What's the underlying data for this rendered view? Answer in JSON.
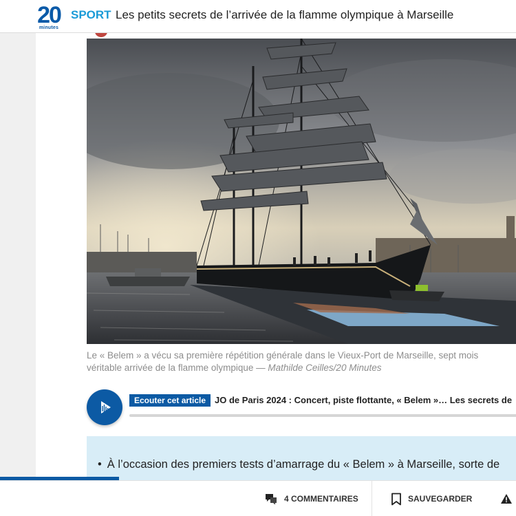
{
  "header": {
    "logo_text": "20",
    "logo_subtext": "minutes",
    "section": "SPORT",
    "headline": "Les petits secrets de l’arrivée de la flamme olympique à Marseille"
  },
  "article": {
    "photo_alt": "Le « Belem » à quai dans le Vieux-Port de Marseille",
    "caption": "Le « Belem » a vécu sa première répétition générale dans le Vieux-Port de Marseille, sept mois",
    "caption_line2": "véritable arrivée de la flamme olympique —",
    "caption_credit": "Mathilde Ceilles/20 Minutes",
    "audio": {
      "badge": "Ecouter cet article",
      "title": "JO de Paris 2024 : Concert, piste flottante, « Belem »… Les secrets de"
    },
    "summary_item": "À l’occasion des premiers tests d’amarrage du « Belem » à Marseille, sorte de"
  },
  "reading_progress": 0.23,
  "bottombar": {
    "comments_label": "4 COMMENTAIRES",
    "save_label": "SAUVEGARDER"
  },
  "icons": {
    "comments": "comments-icon",
    "bookmark": "bookmark-icon",
    "alert": "alert-icon",
    "play": "audio-play-icon"
  },
  "colors": {
    "brand_blue": "#0c5aa4",
    "section_blue": "#1b9bd7",
    "summary_bg": "#d8edf7"
  }
}
